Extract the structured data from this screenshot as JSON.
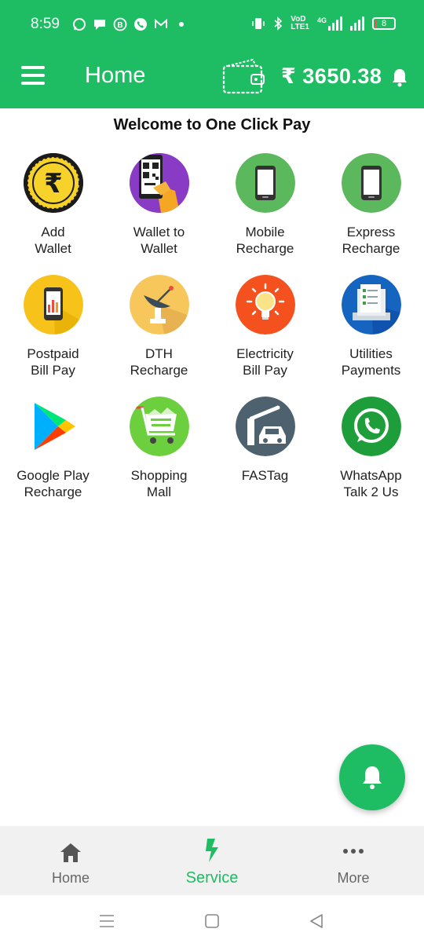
{
  "status_bar": {
    "time": "8:59",
    "notification_icons": [
      "whatsapp-icon",
      "chat-icon",
      "b-icon",
      "phone-icon",
      "gmail-icon",
      "dot-icon"
    ],
    "network_label_top": "VoD",
    "network_label_bottom": "LTE1",
    "network_4g": "4G",
    "battery_level": "8"
  },
  "app_bar": {
    "title": "Home",
    "balance": "₹ 3650.38"
  },
  "welcome_text": "Welcome to One Click Pay",
  "services": [
    {
      "label": "Add\nWallet",
      "icon": "rupee-coin-icon"
    },
    {
      "label": "Wallet to\nWallet",
      "icon": "qr-phone-icon"
    },
    {
      "label": "Mobile\nRecharge",
      "icon": "mobile-phone-icon"
    },
    {
      "label": "Express\nRecharge",
      "icon": "mobile-phone-icon"
    },
    {
      "label": "Postpaid\nBill Pay",
      "icon": "bill-phone-icon"
    },
    {
      "label": "DTH\nRecharge",
      "icon": "satellite-dish-icon"
    },
    {
      "label": "Electricity\nBill Pay",
      "icon": "lightbulb-icon"
    },
    {
      "label": "Utilities\nPayments",
      "icon": "utilities-checklist-icon"
    },
    {
      "label": "Google Play\nRecharge",
      "icon": "google-play-icon"
    },
    {
      "label": "Shopping\nMall",
      "icon": "shopping-cart-icon"
    },
    {
      "label": "FASTag",
      "icon": "toll-car-icon"
    },
    {
      "label": "WhatsApp\nTalk 2 Us",
      "icon": "whatsapp-icon"
    }
  ],
  "bottom_nav": {
    "items": [
      {
        "label": "Home",
        "icon": "home-icon",
        "active": false
      },
      {
        "label": "Service",
        "icon": "lightning-icon",
        "active": true
      },
      {
        "label": "More",
        "icon": "more-dots-icon",
        "active": false
      }
    ]
  },
  "colors": {
    "brand_green": "#1ebd63",
    "nav_background": "#f1f1f1",
    "label_text": "#222222"
  }
}
